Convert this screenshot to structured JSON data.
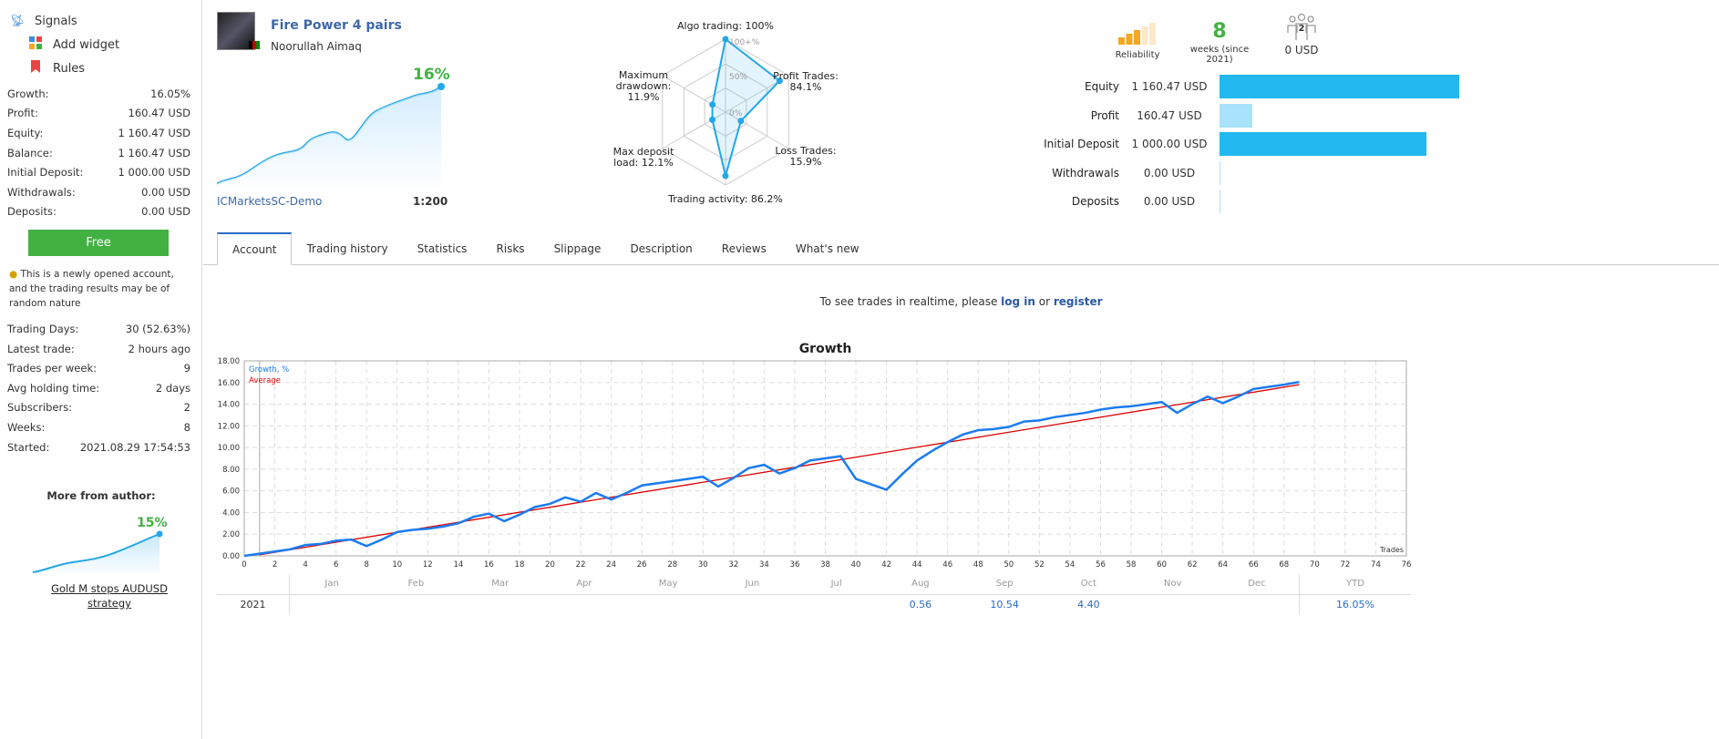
{
  "sidebar": {
    "nav": [
      {
        "label": "Signals",
        "icon": "antenna-icon"
      },
      {
        "label": "Add widget",
        "icon": "widget-icon"
      },
      {
        "label": "Rules",
        "icon": "bookmark-icon"
      }
    ],
    "stats": [
      {
        "k": "Growth:",
        "v": "16.05%"
      },
      {
        "k": "Profit:",
        "v": "160.47 USD"
      },
      {
        "k": "Equity:",
        "v": "1 160.47 USD"
      },
      {
        "k": "Balance:",
        "v": "1 160.47 USD"
      },
      {
        "k": "Initial Deposit:",
        "v": "1 000.00 USD"
      },
      {
        "k": "Withdrawals:",
        "v": "0.00 USD"
      },
      {
        "k": "Deposits:",
        "v": "0.00 USD"
      }
    ],
    "free_label": "Free",
    "note": "This is a newly opened account, and the trading results may be of random nature",
    "stats2": [
      {
        "k": "Trading Days:",
        "v": "30 (52.63%)"
      },
      {
        "k": "Latest trade:",
        "v": "2 hours ago"
      },
      {
        "k": "Trades per week:",
        "v": "9"
      },
      {
        "k": "Avg holding time:",
        "v": "2 days"
      },
      {
        "k": "Subscribers:",
        "v": "2"
      },
      {
        "k": "Weeks:",
        "v": "8"
      },
      {
        "k": "Started:",
        "v": "2021.08.29 17:54:53"
      }
    ],
    "more_title": "More from author:",
    "more_growth": "15%",
    "more_link": "Gold M stops AUDUSD strategy"
  },
  "header": {
    "title": "Fire Power 4 pairs",
    "author": "Noorullah Aimaq",
    "growth": "16%",
    "broker": "ICMarketsSC-Demo",
    "leverage": "1:200"
  },
  "radar": {
    "labels": [
      "Algo trading: 100%",
      "Profit Trades:",
      "84.1%",
      "Loss Trades:",
      "15.9%",
      "Trading activity: 86.2%",
      "Max deposit",
      "load: 12.1%",
      "Maximum",
      "drawdown:",
      "11.9%"
    ],
    "rings": [
      "100+%",
      "50%",
      "0%"
    ],
    "values": [
      100,
      84.1,
      15.9,
      86.2,
      12.1,
      11.9
    ]
  },
  "summary": {
    "reliability_label": "Reliability",
    "reliability_level": 3,
    "weeks": "8",
    "weeks_label": "weeks (since 2021)",
    "subscribers": "2",
    "subscribers_funds": "0 USD"
  },
  "balance_rows": [
    {
      "label": "Equity",
      "value": "1 160.47 USD",
      "pct": 100,
      "color": "#22b8f0"
    },
    {
      "label": "Profit",
      "value": "160.47 USD",
      "pct": 13.8,
      "color": "#a8e2fb"
    },
    {
      "label": "Initial Deposit",
      "value": "1 000.00 USD",
      "pct": 86.2,
      "color": "#22b8f0"
    },
    {
      "label": "Withdrawals",
      "value": "0.00 USD",
      "pct": 0,
      "color": "#22b8f0"
    },
    {
      "label": "Deposits",
      "value": "0.00 USD",
      "pct": 0,
      "color": "#22b8f0"
    }
  ],
  "tabs": [
    "Account",
    "Trading history",
    "Statistics",
    "Risks",
    "Slippage",
    "Description",
    "Reviews",
    "What's new"
  ],
  "realtime": {
    "text": "To see trades in realtime, please ",
    "login": "log in",
    "or": " or ",
    "register": "register"
  },
  "chart_data": {
    "type": "line",
    "title": "Growth",
    "xlabel": "Trades",
    "xlim": [
      0,
      76
    ],
    "ylim": [
      0,
      18
    ],
    "grid": true,
    "legend": "top-left",
    "xticks": [
      0,
      2,
      4,
      6,
      8,
      10,
      12,
      14,
      16,
      18,
      20,
      22,
      24,
      26,
      28,
      30,
      32,
      34,
      36,
      38,
      40,
      42,
      44,
      46,
      48,
      50,
      52,
      54,
      56,
      58,
      60,
      62,
      64,
      66,
      68,
      70,
      72,
      74,
      76
    ],
    "yticks": [
      "0.00",
      "2.00",
      "4.00",
      "6.00",
      "8.00",
      "10.00",
      "12.00",
      "14.00",
      "16.00",
      "18.00"
    ],
    "series": [
      {
        "name": "Growth, %",
        "color": "#1a7cf0",
        "values": [
          0,
          0.2,
          0.4,
          0.6,
          1.0,
          1.1,
          1.4,
          1.5,
          0.9,
          1.5,
          2.2,
          2.4,
          2.5,
          2.7,
          3.0,
          3.6,
          3.9,
          3.2,
          3.8,
          4.5,
          4.8,
          5.4,
          5.0,
          5.8,
          5.2,
          5.8,
          6.5,
          6.7,
          6.9,
          7.1,
          7.3,
          6.4,
          7.2,
          8.1,
          8.4,
          7.6,
          8.1,
          8.8,
          9.0,
          9.2,
          7.1,
          6.6,
          6.1,
          7.5,
          8.8,
          9.7,
          10.5,
          11.2,
          11.6,
          11.7,
          11.9,
          12.4,
          12.5,
          12.8,
          13.0,
          13.2,
          13.5,
          13.7,
          13.8,
          14.0,
          14.2,
          13.2,
          14.0,
          14.7,
          14.1,
          14.7,
          15.4,
          15.6,
          15.8,
          16.05
        ]
      },
      {
        "name": "Average",
        "color": "#e00000",
        "points": [
          [
            1,
            0.1
          ],
          [
            69,
            15.8
          ]
        ]
      }
    ]
  },
  "monthly": {
    "months": [
      "Jan",
      "Feb",
      "Mar",
      "Apr",
      "May",
      "Jun",
      "Jul",
      "Aug",
      "Sep",
      "Oct",
      "Nov",
      "Dec"
    ],
    "ytd_label": "YTD",
    "year": "2021",
    "values": [
      "",
      "",
      "",
      "",
      "",
      "",
      "",
      "0.56",
      "10.54",
      "4.40",
      "",
      ""
    ],
    "ytd": "16.05%"
  }
}
